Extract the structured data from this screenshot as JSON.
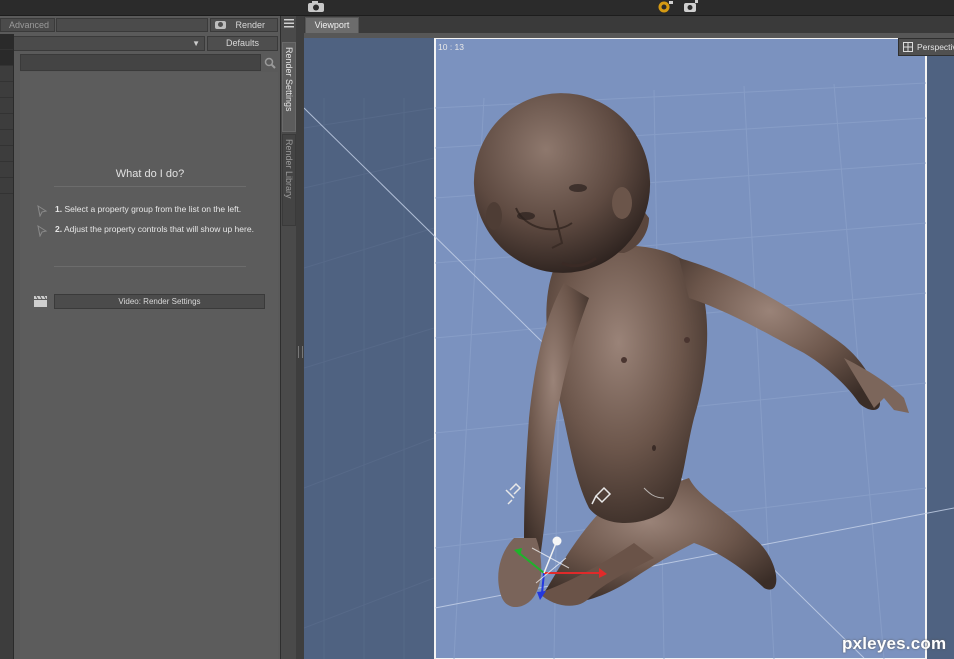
{
  "panel": {
    "tab_advanced": "Advanced",
    "render_label": "Render",
    "defaults_label": "Defaults",
    "what_title": "What do I do?",
    "steps": [
      {
        "num": "1.",
        "text": "Select a property group from the list on the left."
      },
      {
        "num": "2.",
        "text": "Adjust the property controls that will show up here."
      }
    ],
    "video_button": "Video: Render Settings"
  },
  "sidebar": {
    "tabs": [
      {
        "label": "Render Settings",
        "active": true
      },
      {
        "label": "Render Library",
        "active": false
      }
    ]
  },
  "viewport": {
    "tab_label": "Viewport",
    "frame_label": "10 : 13",
    "camera_label": "Perspective View",
    "background_color": "#4f6281",
    "frame_color": "#7b92bf"
  },
  "watermark": "pxleyes.com"
}
